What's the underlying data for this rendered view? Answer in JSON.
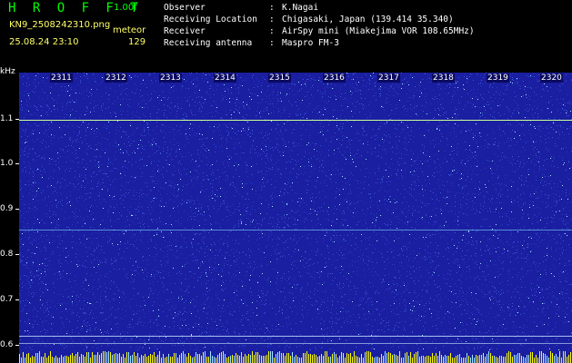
{
  "header": {
    "app_title": "H R O F F T",
    "version": "1.00f",
    "filename": "KN9_2508242310.png",
    "mode_label": "meteor",
    "datetime": "25.08.24 23:10",
    "count": "129",
    "info": [
      {
        "key": "Observer",
        "sep": ":",
        "value": "K.Nagai"
      },
      {
        "key": "Receiving Location",
        "sep": ":",
        "value": "Chigasaki, Japan (139.414 35.340)"
      },
      {
        "key": "Receiver",
        "sep": ":",
        "value": "AirSpy mini (Miakejima VOR 108.65MHz)"
      },
      {
        "key": "Receiving antenna",
        "sep": ":",
        "value": "Maspro FM-3"
      }
    ]
  },
  "spectrogram": {
    "y_unit": "kHz",
    "y_ticks": [
      "1.1",
      "1.0",
      "0.9",
      "0.8",
      "0.7",
      "0.6"
    ],
    "x_ticks": [
      "2311",
      "2312",
      "2313",
      "2314",
      "2315",
      "2316",
      "2317",
      "2318",
      "2319",
      "2320"
    ],
    "colors": {
      "background": "#1a1ea0",
      "noise_dim": "#3b56d8",
      "noise_bright": "#9fe8ff",
      "carrier": "#c8ff9a",
      "bottom_band": "#ffff00"
    }
  }
}
